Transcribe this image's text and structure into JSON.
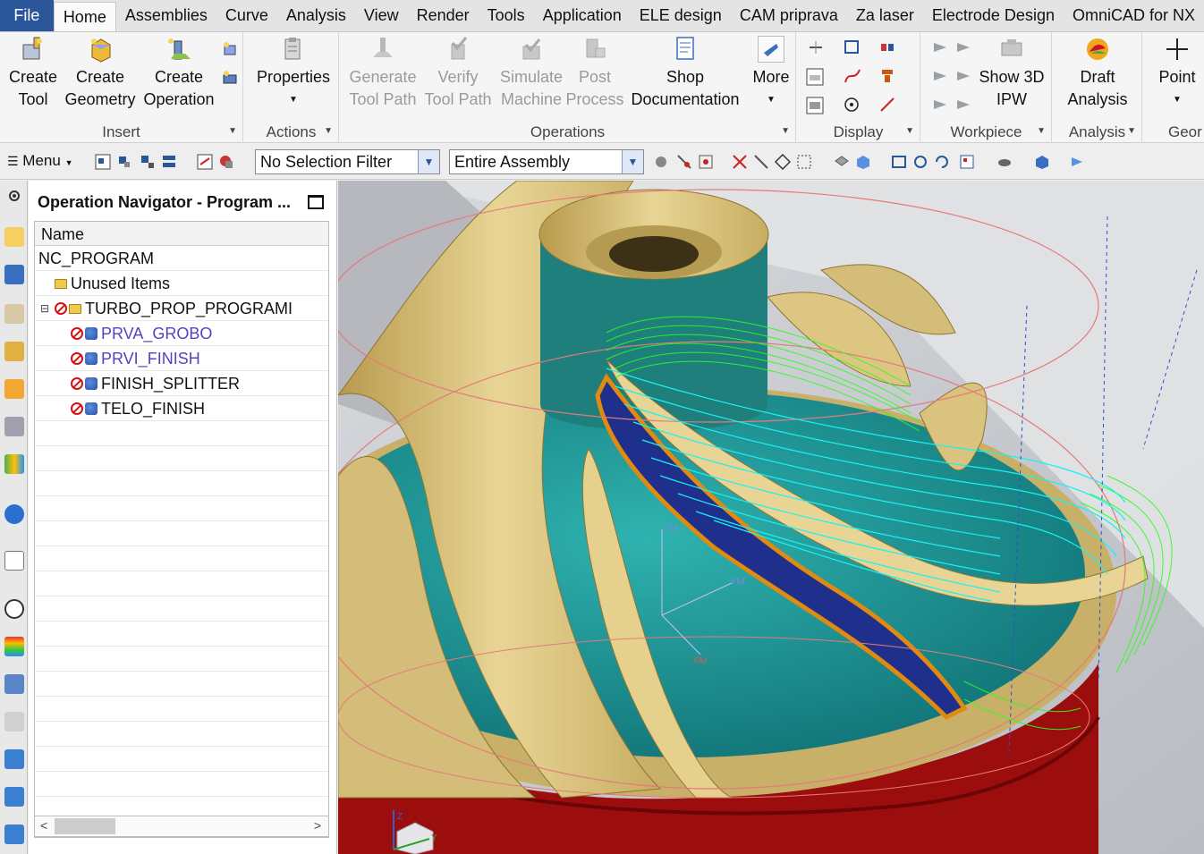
{
  "menubar": {
    "file": "File",
    "tabs": [
      "Home",
      "Assemblies",
      "Curve",
      "Analysis",
      "View",
      "Render",
      "Tools",
      "Application",
      "ELE design",
      "CAM priprava",
      "Za laser",
      "Electrode Design",
      "OmniCAD for NX"
    ],
    "active_tab": "Home"
  },
  "ribbon": {
    "insert": {
      "label": "Insert",
      "create_tool": [
        "Create",
        "Tool"
      ],
      "create_geometry": [
        "Create",
        "Geometry"
      ],
      "create_operation": [
        "Create",
        "Operation"
      ]
    },
    "actions": {
      "label": "Actions",
      "properties": "Properties"
    },
    "operations": {
      "label": "Operations",
      "generate_tool_path": [
        "Generate",
        "Tool Path"
      ],
      "verify_tool_path": [
        "Verify",
        "Tool Path"
      ],
      "simulate_machine": [
        "Simulate",
        "Machine"
      ],
      "post_process": [
        "Post",
        "Process"
      ],
      "shop_documentation": [
        "Shop",
        "Documentation"
      ],
      "more": "More"
    },
    "display": {
      "label": "Display"
    },
    "workpiece": {
      "label": "Workpiece",
      "show_3d_ipw": [
        "Show 3D",
        "IPW"
      ]
    },
    "analysis": {
      "label": "Analysis",
      "draft_analysis": [
        "Draft",
        "Analysis"
      ]
    },
    "geometry": {
      "label": "Geor",
      "point": "Point"
    }
  },
  "toolbar": {
    "menu": "Menu",
    "selection_filter": "No Selection Filter",
    "assembly_scope": "Entire Assembly"
  },
  "navigator": {
    "title": "Operation Navigator - Program ...",
    "column": "Name",
    "rows": [
      {
        "name": "NC_PROGRAM"
      },
      {
        "name": "Unused Items"
      },
      {
        "name": "TURBO_PROP_PROGRAMI"
      },
      {
        "name": "PRVA_GROBO"
      },
      {
        "name": "PRVI_FINISH"
      },
      {
        "name": "FINISH_SPLITTER"
      },
      {
        "name": "TELO_FINISH"
      }
    ]
  },
  "viewport": {
    "axis_labels": [
      "ZM",
      "YM",
      "XM",
      "Z",
      "Y"
    ],
    "colors": {
      "part": "#d8c27a",
      "hub_floor": "#1e8c8c",
      "base": "#9c0e0e",
      "path_rough": "#2aff1a",
      "path_finish": "#18f2f2"
    }
  },
  "icons": [
    "gear-icon",
    "menu-icon",
    "folder-icon",
    "forbidden-icon",
    "operation-icon",
    "point-icon",
    "draft-analysis-icon"
  ]
}
